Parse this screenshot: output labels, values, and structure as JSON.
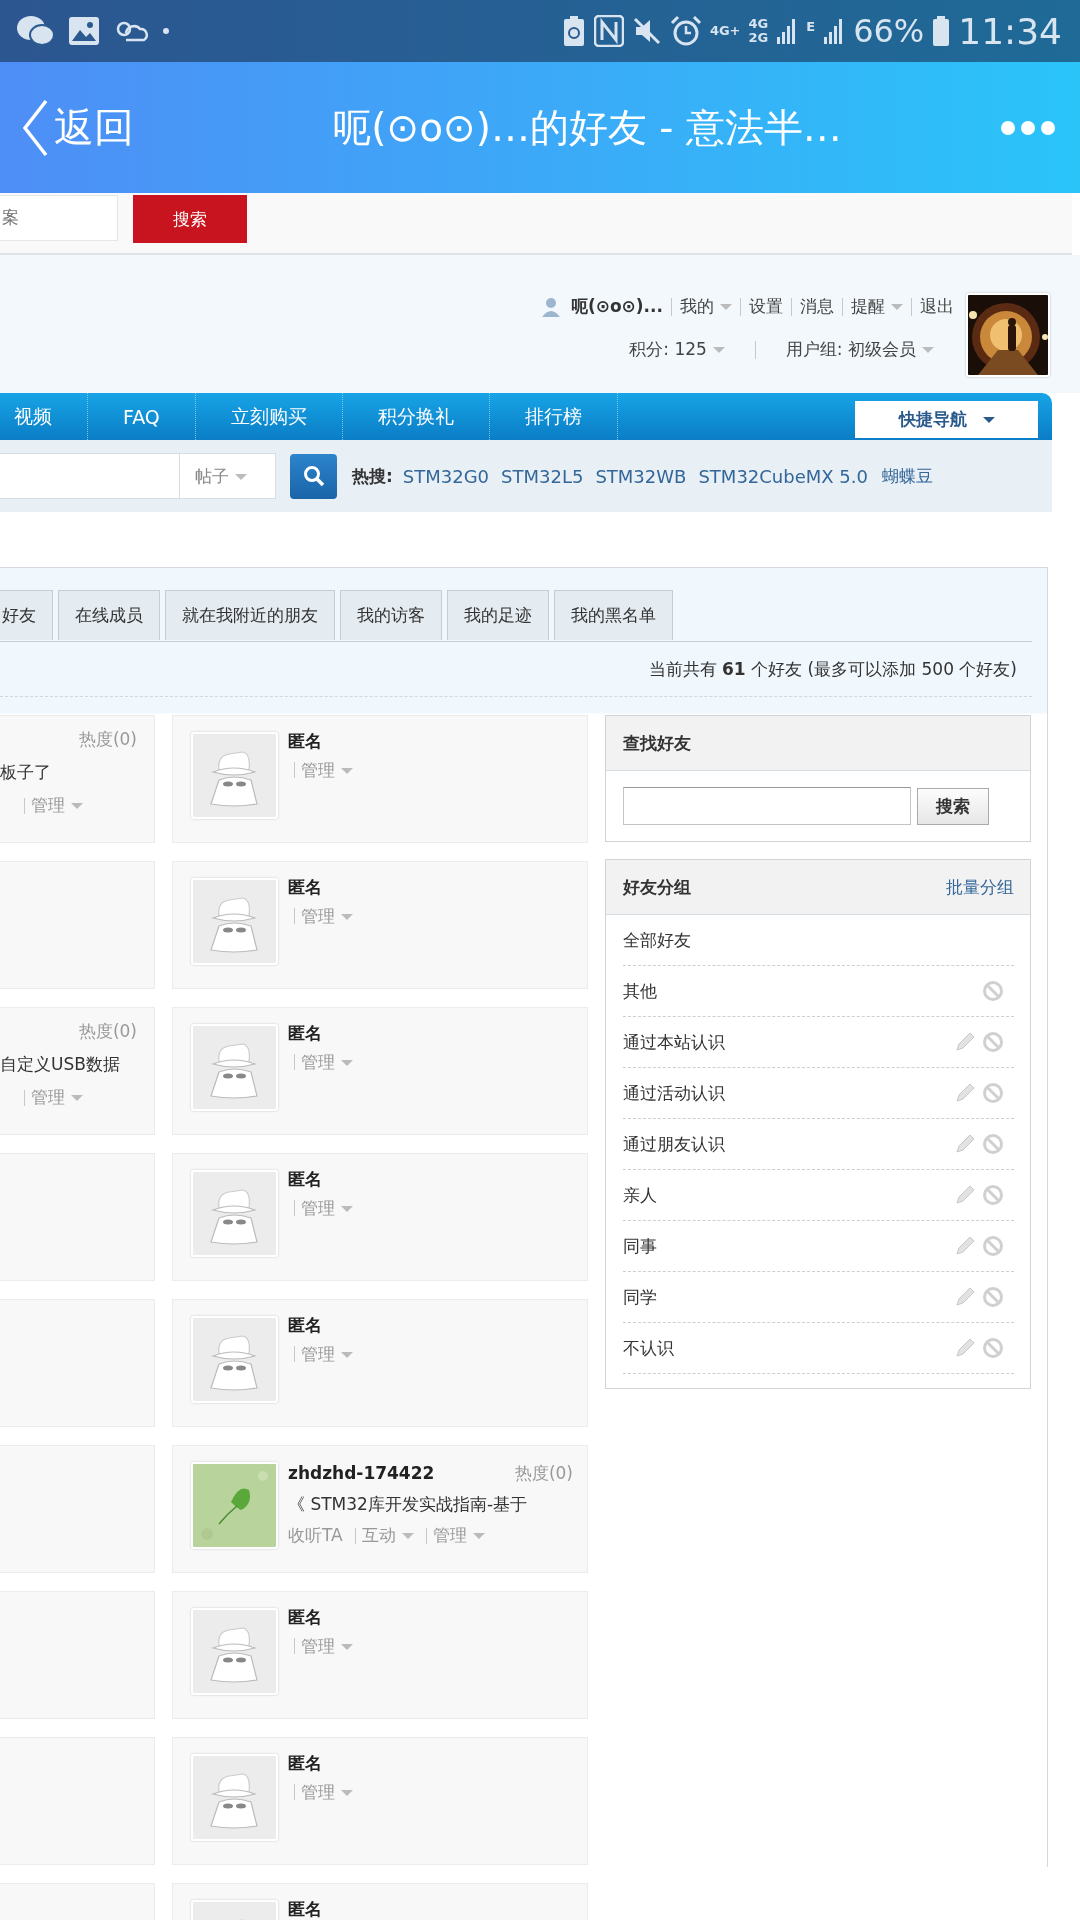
{
  "status_bar": {
    "network_labels": [
      "4G+",
      "4G",
      "2G",
      "E"
    ],
    "battery": "66%",
    "time": "11:34"
  },
  "header": {
    "back": "返回",
    "title": "呃(⊙o⊙)…的好友 - 意法半…"
  },
  "top_search": {
    "placeholder": "案",
    "button": "搜索"
  },
  "user_bar": {
    "username": "呃(⊙o⊙)...",
    "links": [
      {
        "label": "我的",
        "dropdown": true
      },
      {
        "label": "设置",
        "dropdown": false
      },
      {
        "label": "消息",
        "dropdown": false
      },
      {
        "label": "提醒",
        "dropdown": true
      },
      {
        "label": "退出",
        "dropdown": false
      }
    ],
    "points": "积分: 125",
    "group": "用户组: 初级会员"
  },
  "nav": {
    "items": [
      "视频",
      "FAQ",
      "立刻购买",
      "积分换礼",
      "排行榜"
    ],
    "quick_nav": "快捷导航"
  },
  "hot_search": {
    "select": "帖子",
    "label": "热搜:",
    "links": [
      {
        "label": "STM32G0",
        "kind": "latin"
      },
      {
        "label": "STM32L5",
        "kind": "latin"
      },
      {
        "label": "STM32WB",
        "kind": "latin"
      },
      {
        "label": "STM32CubeMX 5.0",
        "kind": "latin"
      },
      {
        "label": "蝴蝶豆",
        "kind": "cjk"
      }
    ]
  },
  "tabs": [
    {
      "label": "好友",
      "selected": false
    },
    {
      "label": "在线成员",
      "selected": false
    },
    {
      "label": "就在我附近的朋友",
      "selected": false
    },
    {
      "label": "我的访客",
      "selected": false
    },
    {
      "label": "我的足迹",
      "selected": false
    },
    {
      "label": "我的黑名单",
      "selected": false
    }
  ],
  "friend_count": "当前共有 **61** 个好友 (最多可以添加 500 个好友)",
  "left_cards": [
    {
      "kind": "partial",
      "heat": "热度(0)",
      "status": "板子了",
      "action": "管理"
    },
    {
      "kind": "blank"
    },
    {
      "kind": "partial",
      "heat": "热度(0)",
      "status": "自定义USB数据",
      "action": "管理"
    },
    {
      "kind": "blank"
    },
    {
      "kind": "blank"
    },
    {
      "kind": "blank"
    },
    {
      "kind": "blank"
    },
    {
      "kind": "blank"
    },
    {
      "kind": "blank"
    }
  ],
  "right_cards": [
    {
      "kind": "anonymous",
      "name": "匿名",
      "actions": [
        {
          "label": "管理",
          "dropdown": true
        }
      ]
    },
    {
      "kind": "anonymous",
      "name": "匿名",
      "actions": [
        {
          "label": "管理",
          "dropdown": true
        }
      ]
    },
    {
      "kind": "anonymous",
      "name": "匿名",
      "actions": [
        {
          "label": "管理",
          "dropdown": true
        }
      ]
    },
    {
      "kind": "anonymous",
      "name": "匿名",
      "actions": [
        {
          "label": "管理",
          "dropdown": true
        }
      ]
    },
    {
      "kind": "anonymous",
      "name": "匿名",
      "actions": [
        {
          "label": "管理",
          "dropdown": true
        }
      ]
    },
    {
      "kind": "picture",
      "name": "zhdzhd-174422",
      "heat": "热度(0)",
      "status": "《 STM32库开发实战指南-基于",
      "actions": [
        {
          "label": "收听TA",
          "dropdown": false
        },
        {
          "label": "互动",
          "dropdown": true
        },
        {
          "label": "管理",
          "dropdown": true
        }
      ]
    },
    {
      "kind": "anonymous",
      "name": "匿名",
      "actions": [
        {
          "label": "管理",
          "dropdown": true
        }
      ]
    },
    {
      "kind": "anonymous",
      "name": "匿名",
      "actions": [
        {
          "label": "管理",
          "dropdown": true
        }
      ]
    },
    {
      "kind": "anonymous",
      "name": "匿名"
    }
  ],
  "find_friend": {
    "title": "查找好友",
    "button": "搜索"
  },
  "groups": {
    "title": "好友分组",
    "batch": "批量分组",
    "items": [
      {
        "label": "全部好友",
        "editable": false,
        "deletable": false
      },
      {
        "label": "其他",
        "editable": false,
        "deletable": true
      },
      {
        "label": "通过本站认识",
        "editable": true,
        "deletable": true
      },
      {
        "label": "通过活动认识",
        "editable": true,
        "deletable": true
      },
      {
        "label": "通过朋友认识",
        "editable": true,
        "deletable": true
      },
      {
        "label": "亲人",
        "editable": true,
        "deletable": true
      },
      {
        "label": "同事",
        "editable": true,
        "deletable": true
      },
      {
        "label": "同学",
        "editable": true,
        "deletable": true
      },
      {
        "label": "不认识",
        "editable": true,
        "deletable": true
      }
    ]
  }
}
